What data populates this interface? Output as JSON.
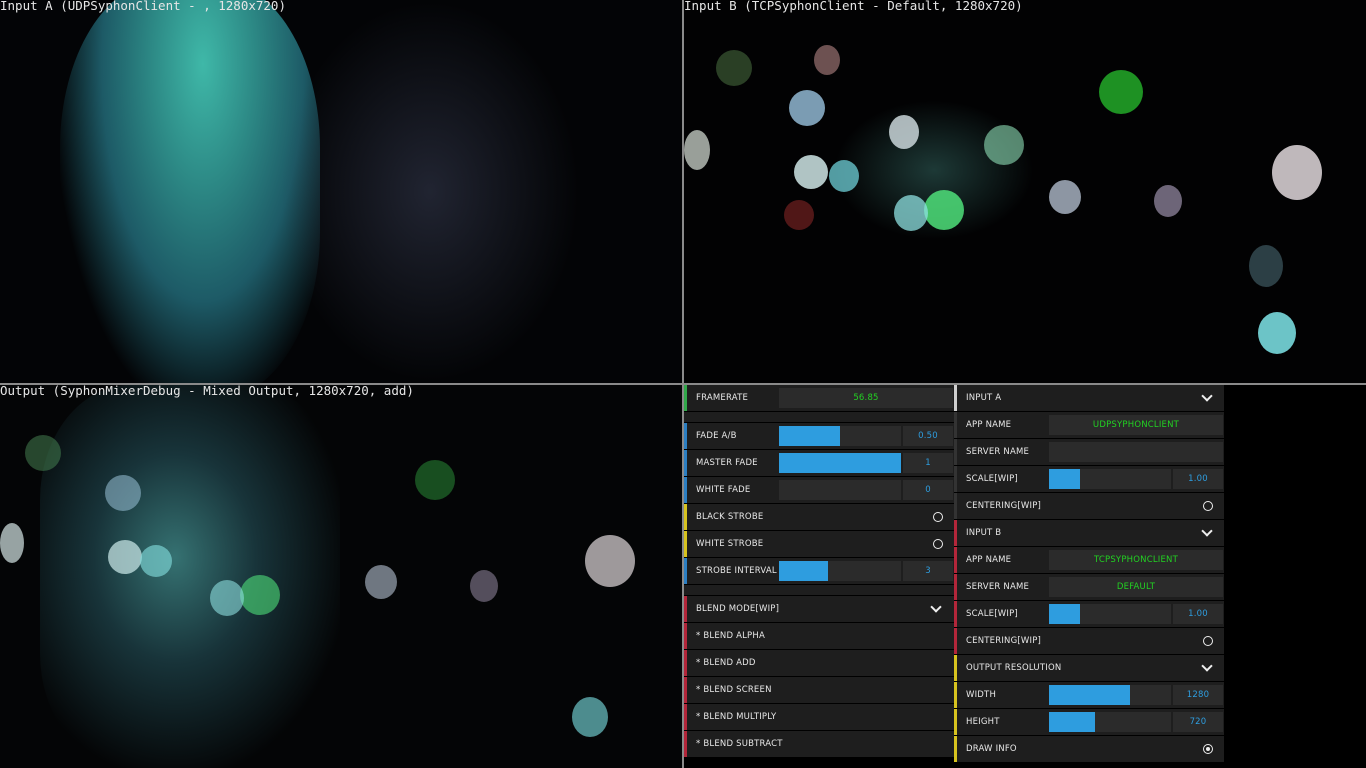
{
  "panes": {
    "input_a_label": "Input A (UDPSyphonClient - , 1280x720)",
    "input_b_label": "Input B (TCPSyphonClient - Default, 1280x720)",
    "output_label": "Output (SyphonMixerDebug - Mixed Output, 1280x720, add)"
  },
  "mixer": {
    "framerate_label": "FRAMERATE",
    "framerate_value": "56.85",
    "fade_ab_label": "FADE A/B",
    "fade_ab_value": "0.50",
    "fade_ab_fraction": 0.5,
    "master_fade_label": "MASTER FADE",
    "master_fade_value": "1",
    "master_fade_fraction": 1,
    "white_fade_label": "WHITE FADE",
    "white_fade_value": "0",
    "white_fade_fraction": 0,
    "black_strobe_label": "BLACK STROBE",
    "black_strobe_on": false,
    "white_strobe_label": "WHITE STROBE",
    "white_strobe_on": false,
    "strobe_interval_label": "STROBE INTERVAL",
    "strobe_interval_value": "3",
    "strobe_interval_fraction": 0.4,
    "blend_mode_label": "BLEND MODE[WIP]",
    "blend_options": [
      "* BLEND ALPHA",
      "* BLEND ADD",
      "* BLEND SCREEN",
      "* BLEND MULTIPLY",
      "* BLEND SUBTRACT"
    ]
  },
  "inputs": {
    "input_a": {
      "header": "INPUT A",
      "app_name_label": "APP NAME",
      "app_name_value": "UDPSYPHONCLIENT",
      "server_name_label": "SERVER NAME",
      "server_name_value": "",
      "scale_label": "SCALE[WIP]",
      "scale_value": "1.00",
      "scale_fraction": 0.25,
      "centering_label": "CENTERING[WIP]",
      "centering_on": false
    },
    "input_b": {
      "header": "INPUT B",
      "app_name_label": "APP NAME",
      "app_name_value": "TCPSYPHONCLIENT",
      "server_name_label": "SERVER NAME",
      "server_name_value": "DEFAULT",
      "scale_label": "SCALE[WIP]",
      "scale_value": "1.00",
      "scale_fraction": 0.25,
      "centering_label": "CENTERING[WIP]",
      "centering_on": false
    },
    "output_resolution": {
      "header": "OUTPUT RESOLUTION",
      "width_label": "WIDTH",
      "width_value": "1280",
      "width_fraction": 0.667,
      "height_label": "HEIGHT",
      "height_value": "720",
      "height_fraction": 0.375,
      "draw_info_label": "DRAW INFO",
      "draw_info_on": true
    }
  },
  "colors": {
    "slider_fill": "#2e9ddf",
    "text_value": "#22d122",
    "accent_green": "#31a84a",
    "accent_blue": "#2c7fc2",
    "accent_yellow": "#d7c31f",
    "accent_red": "#b3263a"
  }
}
